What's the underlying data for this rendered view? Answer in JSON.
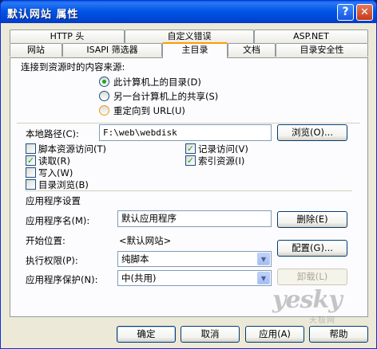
{
  "window": {
    "title": "默认网站 属性"
  },
  "tabs_row1": [
    {
      "label": "HTTP 头"
    },
    {
      "label": "自定义错误"
    },
    {
      "label": "ASP.NET"
    }
  ],
  "tabs_row2": [
    {
      "label": "网站"
    },
    {
      "label": "ISAPI 筛选器"
    },
    {
      "label": "主目录"
    },
    {
      "label": "文档"
    },
    {
      "label": "目录安全性"
    }
  ],
  "source": {
    "label": "连接到资源时的内容来源:",
    "options": [
      {
        "label": "此计算机上的目录(D)",
        "selected": true
      },
      {
        "label": "另一台计算机上的共享(S)",
        "selected": false
      },
      {
        "label": "重定向到 URL(U)",
        "selected": false
      }
    ]
  },
  "local_path": {
    "label": "本地路径(C):",
    "value": "F:\\web\\webdisk",
    "browse_label": "浏览(O)..."
  },
  "permissions": [
    {
      "label": "脚本资源访问(T)",
      "checked": false
    },
    {
      "label": "记录访问(V)",
      "checked": true
    },
    {
      "label": "读取(R)",
      "checked": true
    },
    {
      "label": "索引资源(I)",
      "checked": true
    },
    {
      "label": "写入(W)",
      "checked": false
    },
    {
      "label": "目录浏览(B)",
      "checked": false
    }
  ],
  "app": {
    "section_title": "应用程序设置",
    "name_label": "应用程序名(M):",
    "name_value": "默认应用程序",
    "remove_label": "删除(E)",
    "start_label": "开始位置:",
    "start_value": "<默认网站>",
    "config_label": "配置(G)...",
    "exec_label": "执行权限(P):",
    "exec_value": "纯脚本",
    "protect_label": "应用程序保护(N):",
    "protect_value": "中(共用)",
    "unload_label": "卸载(L)"
  },
  "watermark": {
    "text": "yesky",
    "sub": "天极网"
  },
  "footer": {
    "ok": "确定",
    "cancel": "取消",
    "apply": "应用(A)",
    "help": "帮助"
  },
  "titlebar": {
    "help_glyph": "?",
    "close_glyph": "✕"
  }
}
